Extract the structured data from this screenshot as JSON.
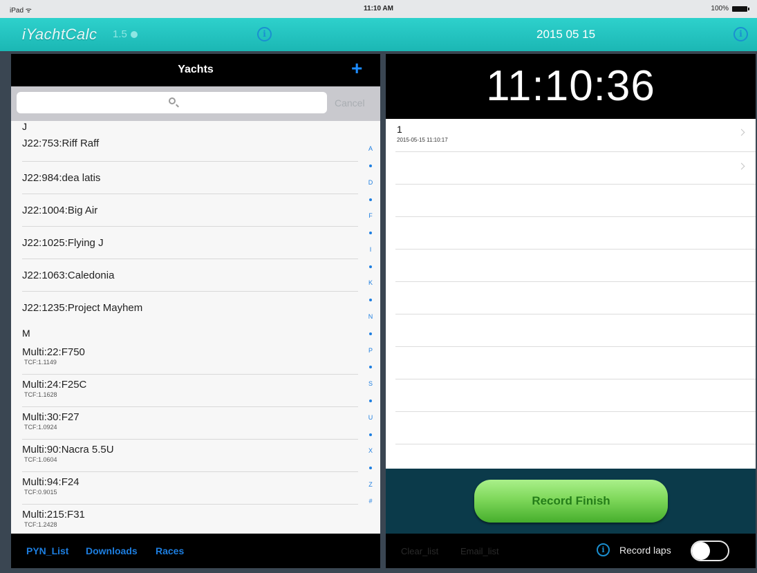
{
  "status_bar": {
    "carrier": "iPad ᯤ",
    "time": "11:10 AM",
    "battery": "100%"
  },
  "app_bar": {
    "app_name": "iYachtCalc",
    "version": "1.5",
    "date": "2015 05 15",
    "info_glyph": "i"
  },
  "left_panel": {
    "title": "Yachts",
    "add_glyph": "+",
    "search": {
      "placeholder": "",
      "cancel_label": "Cancel"
    },
    "section_j": "J",
    "yachts_j": [
      "J22:753:Riff Raff",
      "J22:984:dea latis",
      "J22:1004:Big Air",
      "J22:1025:Flying J",
      "J22:1063:Caledonia",
      "J22:1235:Project Mayhem"
    ],
    "section_m": "M",
    "yachts_m": [
      {
        "name": "Multi:22:F750",
        "tcf": "TCF:1.1149"
      },
      {
        "name": "Multi:24:F25C",
        "tcf": "TCF:1.1628"
      },
      {
        "name": "Multi:30:F27",
        "tcf": "TCF:1.0924"
      },
      {
        "name": "Multi:90:Nacra 5.5U",
        "tcf": "TCF:1.0604"
      },
      {
        "name": "Multi:94:F24",
        "tcf": "TCF:0.9015"
      },
      {
        "name": "Multi:215:F31",
        "tcf": "TCF:1.2428"
      }
    ],
    "index_letters": [
      "A",
      "D",
      "F",
      "I",
      "K",
      "N",
      "P",
      "S",
      "U",
      "X",
      "Z",
      "#"
    ],
    "footer": {
      "pyn_list": "PYN_List",
      "downloads": "Downloads",
      "races": "Races"
    }
  },
  "right_panel": {
    "clock": "11:10:36",
    "laps": [
      {
        "number": "1",
        "timestamp": "2015-05-15 11:10:17"
      }
    ],
    "record_finish_label": "Record Finish",
    "footer": {
      "clear_list": "Clear_list",
      "email_list": "Email_list",
      "record_laps_label": "Record laps",
      "record_laps_on": false
    }
  },
  "colors": {
    "title_bar": "#22c7c3",
    "accent_blue": "#1d7ee0",
    "finish_green": "#7fd85b",
    "finish_panel": "#0b3a4a"
  }
}
